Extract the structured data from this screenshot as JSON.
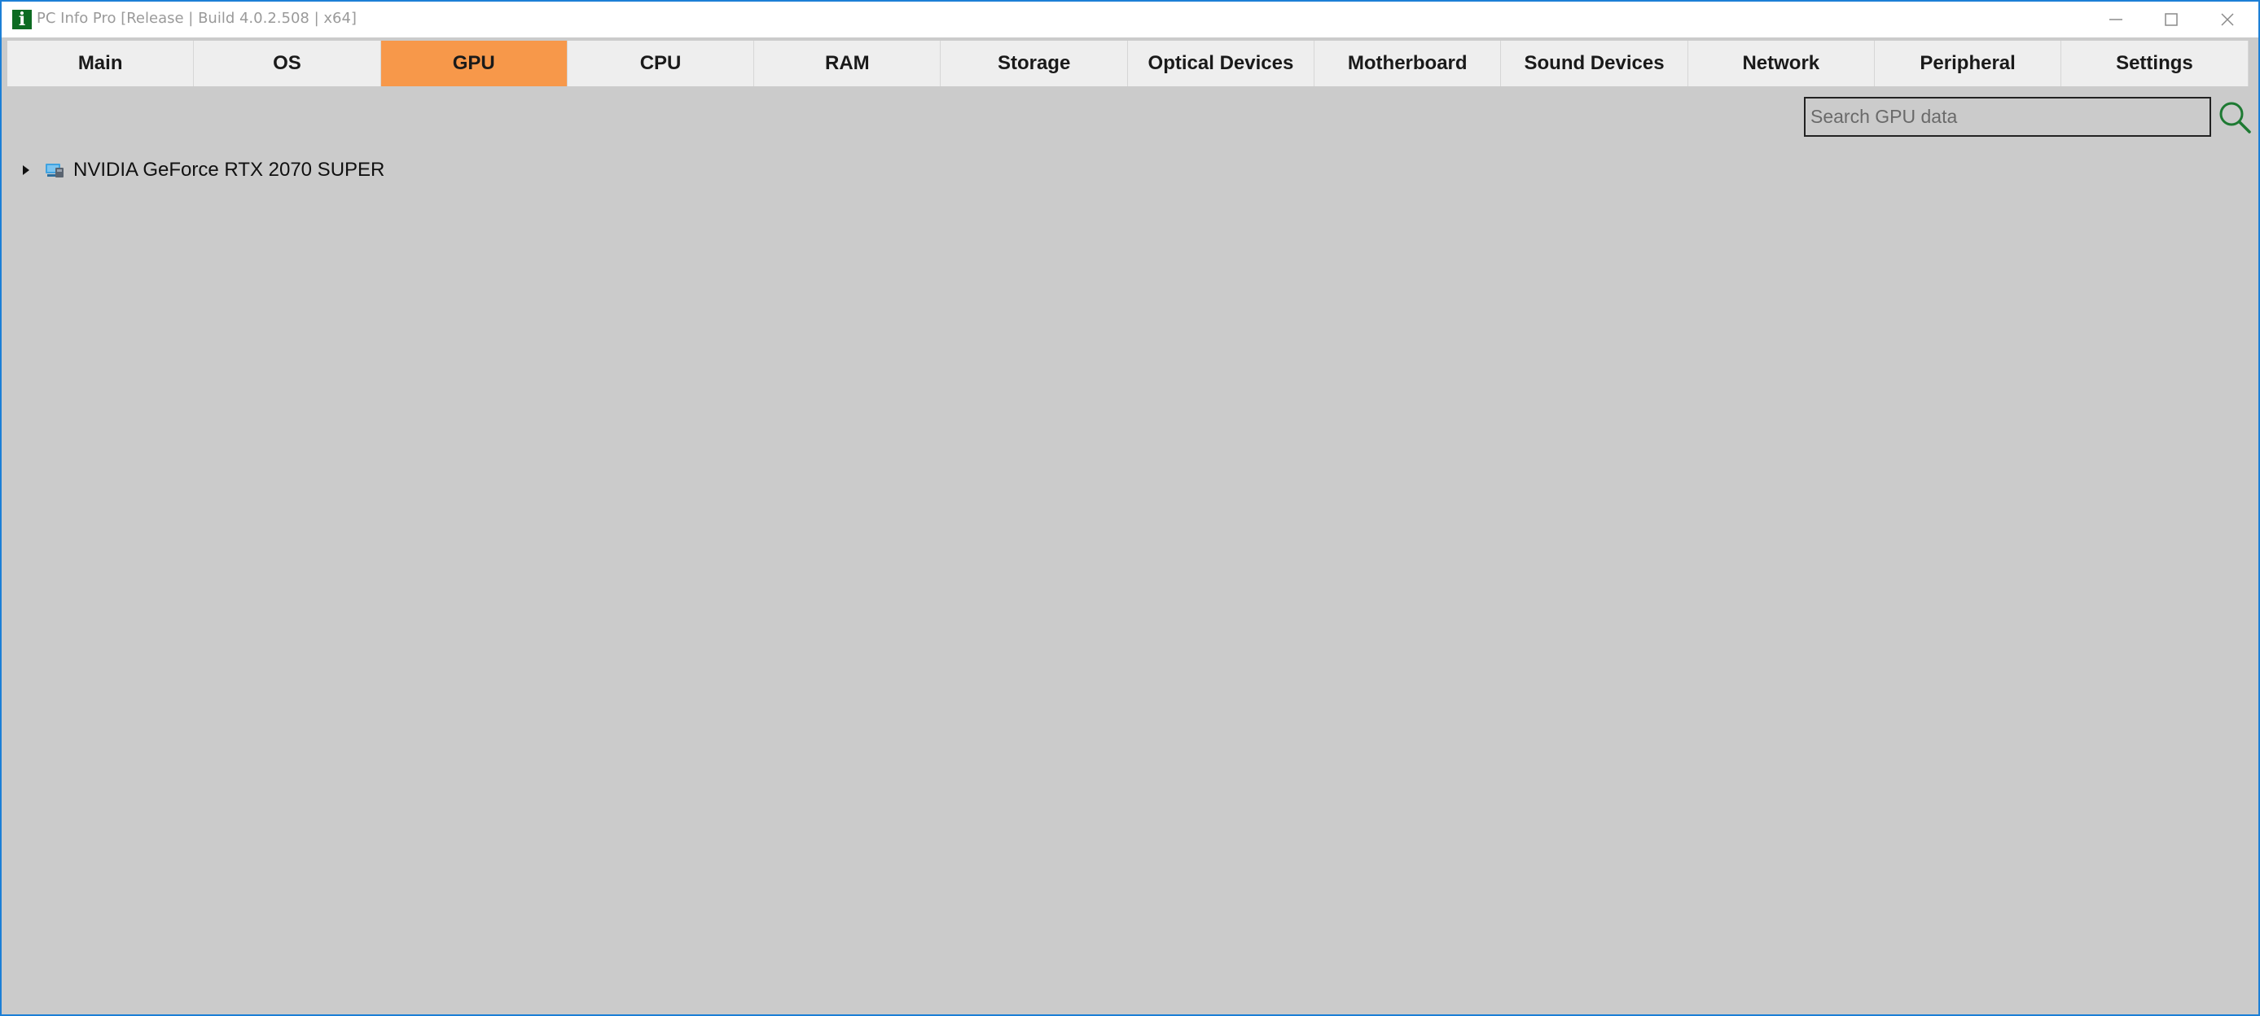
{
  "window": {
    "title": "PC Info Pro [Release | Build 4.0.2.508 | x64]",
    "app_icon_glyph": "i",
    "controls": [
      "minimize-icon",
      "maximize-icon",
      "close-icon"
    ]
  },
  "tabs": [
    {
      "label": "Main",
      "active": false
    },
    {
      "label": "OS",
      "active": false
    },
    {
      "label": "GPU",
      "active": true
    },
    {
      "label": "CPU",
      "active": false
    },
    {
      "label": "RAM",
      "active": false
    },
    {
      "label": "Storage",
      "active": false
    },
    {
      "label": "Optical Devices",
      "active": false
    },
    {
      "label": "Motherboard",
      "active": false
    },
    {
      "label": "Sound Devices",
      "active": false
    },
    {
      "label": "Network",
      "active": false
    },
    {
      "label": "Peripheral",
      "active": false
    },
    {
      "label": "Settings",
      "active": false
    }
  ],
  "search": {
    "placeholder": "Search GPU data",
    "value": "",
    "icon": "search-icon"
  },
  "tree": {
    "items": [
      {
        "label": "NVIDIA GeForce RTX 2070 SUPER",
        "icon": "gpu-icon",
        "expanded": false
      }
    ]
  },
  "colors": {
    "active_tab": "#f7984a",
    "tab_background": "#eeeeee",
    "content_background": "#cbcbcb",
    "app_icon": "#0d6b22",
    "window_border": "#1c7fd6"
  }
}
